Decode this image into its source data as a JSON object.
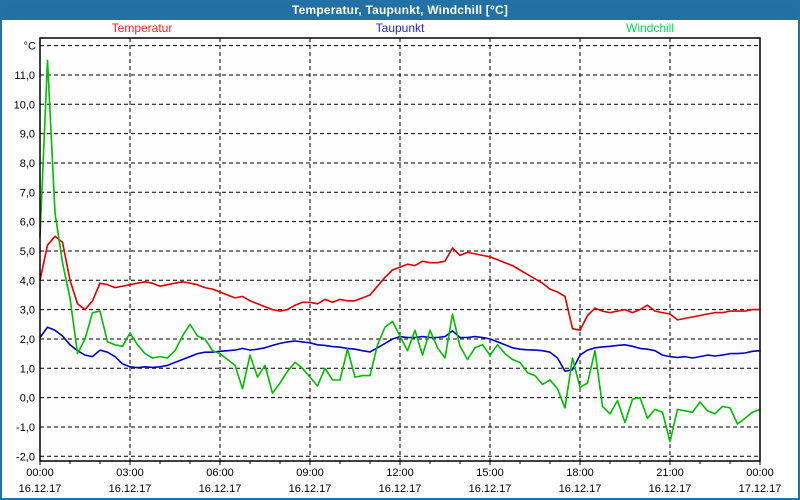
{
  "header": {
    "title": "Temperatur, Taupunkt, Windchill [°C]"
  },
  "colors": {
    "frame": "#2471a8",
    "titlebar_bg": "#2171a5",
    "titlebar_text": "#ffffff",
    "plot_bg": "#fefefe",
    "grid": "#000000",
    "axis_text": "#000000"
  },
  "chart_data": {
    "type": "line",
    "title": "Temperatur, Taupunkt, Windchill [°C]",
    "grid": "dashed",
    "legend_position": "top",
    "y_axis": {
      "unit": "°C",
      "ylim": [
        -2.16,
        12.26
      ],
      "grid_min": -2,
      "grid_max": 12,
      "grid_step": 1,
      "tick_labels": [
        {
          "v": 11,
          "label": "11,0"
        },
        {
          "v": 10,
          "label": "10,0"
        },
        {
          "v": 9,
          "label": "9,0"
        },
        {
          "v": 8,
          "label": "8,0"
        },
        {
          "v": 7,
          "label": "7,0"
        },
        {
          "v": 6,
          "label": "6,0"
        },
        {
          "v": 5,
          "label": "5,0"
        },
        {
          "v": 4,
          "label": "4,0"
        },
        {
          "v": 3,
          "label": "3,0"
        },
        {
          "v": 2,
          "label": "2,0"
        },
        {
          "v": 1,
          "label": "1,0"
        },
        {
          "v": 0,
          "label": "0,0"
        },
        {
          "v": -1,
          "label": "-1,0"
        },
        {
          "v": -2,
          "label": "-2,0"
        }
      ]
    },
    "x_axis": {
      "xlim": [
        0,
        24
      ],
      "minor_step_hours": 1,
      "major_ticks": [
        {
          "h": 0,
          "time": "00:00",
          "date": "16.12.17"
        },
        {
          "h": 3,
          "time": "03:00",
          "date": "16.12.17"
        },
        {
          "h": 6,
          "time": "06:00",
          "date": "16.12.17"
        },
        {
          "h": 9,
          "time": "09:00",
          "date": "16.12.17"
        },
        {
          "h": 12,
          "time": "12:00",
          "date": "16.12.17"
        },
        {
          "h": 15,
          "time": "15:00",
          "date": "16.12.17"
        },
        {
          "h": 18,
          "time": "18:00",
          "date": "16.12.17"
        },
        {
          "h": 21,
          "time": "21:00",
          "date": "16.12.17"
        },
        {
          "h": 24,
          "time": "00:00",
          "date": "17.12.17"
        }
      ]
    },
    "series": [
      {
        "name": "Temperatur",
        "color": "#dd0000",
        "legend_color": "#ff2222",
        "start_hour": 0,
        "step_hours": 0.25,
        "values": [
          4.0,
          5.2,
          5.5,
          5.3,
          4.0,
          3.2,
          3.0,
          3.3,
          3.9,
          3.85,
          3.75,
          3.8,
          3.85,
          3.9,
          3.95,
          3.9,
          3.8,
          3.85,
          3.9,
          3.95,
          3.9,
          3.85,
          3.75,
          3.7,
          3.6,
          3.5,
          3.4,
          3.45,
          3.3,
          3.2,
          3.1,
          3.0,
          2.95,
          3.0,
          3.15,
          3.25,
          3.25,
          3.2,
          3.35,
          3.25,
          3.35,
          3.3,
          3.3,
          3.4,
          3.5,
          3.8,
          4.1,
          4.35,
          4.45,
          4.55,
          4.5,
          4.65,
          4.6,
          4.6,
          4.65,
          5.1,
          4.85,
          4.95,
          4.9,
          4.85,
          4.8,
          4.7,
          4.6,
          4.5,
          4.35,
          4.2,
          4.05,
          3.9,
          3.7,
          3.6,
          3.45,
          2.35,
          2.3,
          2.8,
          3.05,
          2.95,
          2.9,
          2.95,
          3.0,
          2.9,
          3.0,
          3.15,
          2.95,
          2.9,
          2.85,
          2.65,
          2.7,
          2.75,
          2.8,
          2.85,
          2.9,
          2.9,
          2.95,
          2.95,
          2.95,
          3.0,
          3.0
        ]
      },
      {
        "name": "Taupunkt",
        "color": "#0000cc",
        "legend_color": "#2222ff",
        "start_hour": 0,
        "step_hours": 0.25,
        "values": [
          2.05,
          2.4,
          2.3,
          2.1,
          1.8,
          1.6,
          1.45,
          1.4,
          1.62,
          1.55,
          1.4,
          1.15,
          1.05,
          1.02,
          1.05,
          1.03,
          1.05,
          1.1,
          1.2,
          1.3,
          1.4,
          1.5,
          1.55,
          1.55,
          1.58,
          1.6,
          1.62,
          1.68,
          1.62,
          1.65,
          1.7,
          1.78,
          1.85,
          1.9,
          1.93,
          1.9,
          1.87,
          1.8,
          1.78,
          1.74,
          1.72,
          1.68,
          1.65,
          1.6,
          1.56,
          1.7,
          1.85,
          2.0,
          2.08,
          2.05,
          2.05,
          2.08,
          2.05,
          2.05,
          2.08,
          2.28,
          2.05,
          2.05,
          2.08,
          2.05,
          2.0,
          1.9,
          1.8,
          1.7,
          1.65,
          1.63,
          1.62,
          1.6,
          1.55,
          1.35,
          0.9,
          0.95,
          1.45,
          1.62,
          1.7,
          1.73,
          1.75,
          1.78,
          1.8,
          1.75,
          1.68,
          1.65,
          1.6,
          1.45,
          1.4,
          1.37,
          1.4,
          1.35,
          1.4,
          1.45,
          1.42,
          1.45,
          1.5,
          1.5,
          1.52,
          1.58,
          1.6
        ]
      },
      {
        "name": "Windchill",
        "color": "#00bb00",
        "legend_color": "#00dd55",
        "start_hour": 0,
        "step_hours": 0.25,
        "values": [
          5.5,
          11.5,
          6.3,
          4.6,
          3.4,
          1.5,
          2.0,
          2.9,
          2.95,
          1.9,
          1.8,
          1.75,
          2.2,
          1.8,
          1.5,
          1.35,
          1.4,
          1.35,
          1.6,
          2.1,
          2.5,
          2.1,
          2.0,
          1.6,
          1.5,
          1.3,
          1.1,
          0.3,
          1.45,
          0.7,
          1.1,
          0.15,
          0.5,
          0.9,
          1.2,
          1.0,
          0.7,
          0.4,
          1.0,
          0.6,
          0.6,
          1.65,
          0.7,
          0.75,
          0.75,
          1.8,
          2.4,
          2.6,
          2.1,
          1.6,
          2.3,
          1.45,
          2.3,
          1.7,
          1.35,
          2.85,
          1.75,
          1.3,
          1.7,
          1.8,
          1.45,
          1.8,
          1.5,
          1.3,
          1.2,
          0.85,
          0.75,
          0.45,
          0.6,
          0.3,
          -0.35,
          1.35,
          0.35,
          0.5,
          1.6,
          -0.3,
          -0.55,
          -0.1,
          -0.85,
          -0.05,
          0.0,
          -0.7,
          -0.4,
          -0.5,
          -1.5,
          -0.4,
          -0.45,
          -0.5,
          -0.15,
          -0.45,
          -0.55,
          -0.3,
          -0.35,
          -0.9,
          -0.7,
          -0.5,
          -0.4
        ]
      }
    ]
  }
}
